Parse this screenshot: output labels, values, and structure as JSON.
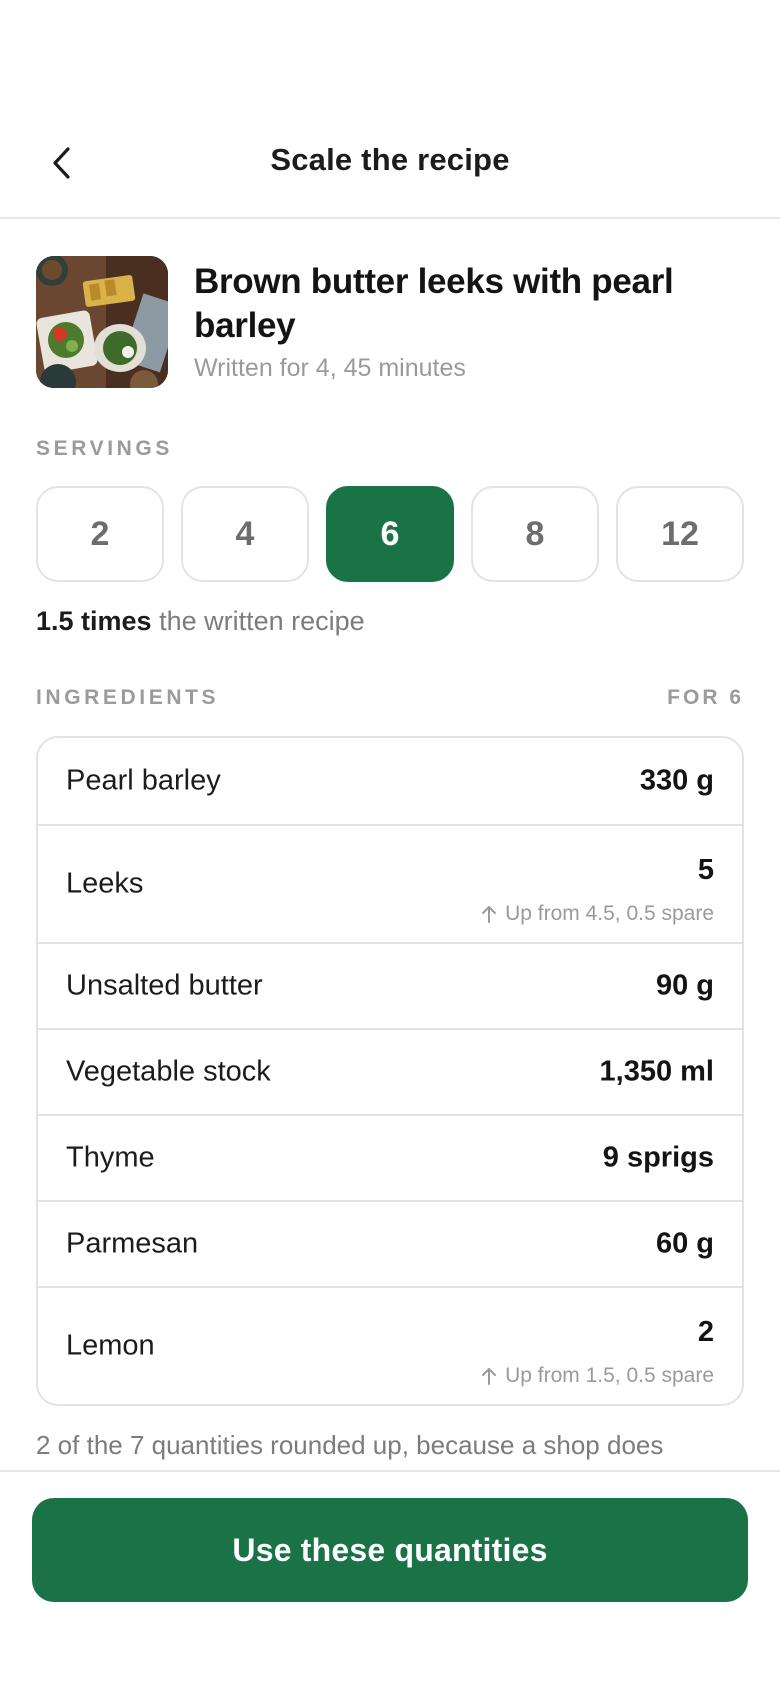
{
  "header": {
    "title": "Scale the recipe",
    "back_icon": "chevron-left-icon"
  },
  "recipe": {
    "name": "Brown butter leeks with pearl barley",
    "meta": "Written for 4, 45 minutes",
    "thumbnail": "recipe-photo"
  },
  "servings": {
    "label": "SERVINGS",
    "options": [
      "2",
      "4",
      "6",
      "8",
      "12"
    ],
    "selected": "6"
  },
  "multiplier": {
    "factor": "1.5 times",
    "suffix": " the written recipe"
  },
  "ingredients": {
    "label": "INGREDIENTS",
    "for_label": "FOR 6",
    "items": [
      {
        "name": "Pearl barley",
        "qty": "330 g",
        "note": ""
      },
      {
        "name": "Leeks",
        "qty": "5",
        "note": "Up from 4.5, 0.5 spare"
      },
      {
        "name": "Unsalted butter",
        "qty": "90 g",
        "note": ""
      },
      {
        "name": "Vegetable stock",
        "qty": "1,350 ml",
        "note": ""
      },
      {
        "name": "Thyme",
        "qty": "9 sprigs",
        "note": ""
      },
      {
        "name": "Parmesan",
        "qty": "60 g",
        "note": ""
      },
      {
        "name": "Lemon",
        "qty": "2",
        "note": "Up from 1.5, 0.5 spare"
      }
    ]
  },
  "footnote": "2 of the 7 quantities rounded up, because a shop does",
  "cta": {
    "label": "Use these quantities"
  },
  "colors": {
    "accent": "#1a7346",
    "border": "#e3e3e3",
    "muted": "#9a9a9a"
  }
}
